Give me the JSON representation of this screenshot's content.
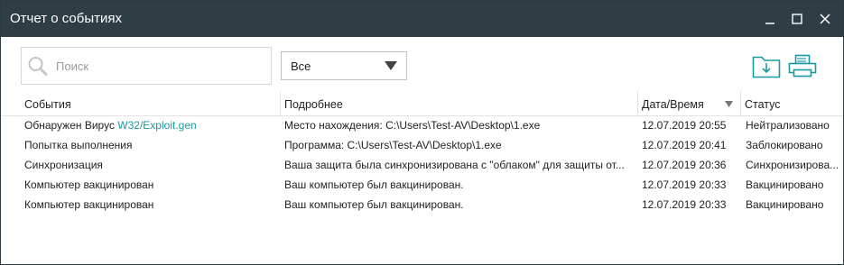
{
  "window": {
    "title": "Отчет о событиях"
  },
  "search": {
    "placeholder": "Поиск"
  },
  "filter": {
    "selected": "Все"
  },
  "columns": [
    "События",
    "Подробнее",
    "Дата/Время",
    "Статус"
  ],
  "rows": [
    {
      "event": "Обнаружен Вирус ",
      "virus": "W32/Exploit.gen",
      "details": "Место нахождения: C:\\Users\\Test-AV\\Desktop\\1.exe",
      "datetime": "12.07.2019 20:55",
      "status": "Нейтрализовано"
    },
    {
      "event": "Попытка выполнения",
      "virus": "",
      "details": "Программа: C:\\Users\\Test-AV\\Desktop\\1.exe",
      "datetime": "12.07.2019 20:41",
      "status": "Заблокировано"
    },
    {
      "event": "Синхронизация",
      "virus": "",
      "details": "Ваша защита была синхронизирована с \"облаком\" для защиты от...",
      "datetime": "12.07.2019 20:36",
      "status": "Синхронизирова..."
    },
    {
      "event": "Компьютер вакцинирован",
      "virus": "",
      "details": "Ваш компьютер был вакцинирован.",
      "datetime": "12.07.2019 20:33",
      "status": "Вакцинировано"
    },
    {
      "event": "Компьютер вакцинирован",
      "virus": "",
      "details": "Ваш компьютер был вакцинирован.",
      "datetime": "12.07.2019 20:33",
      "status": "Вакцинировано"
    }
  ],
  "icons": {
    "search": "search-icon",
    "dropdown": "chevron-down-icon",
    "export": "folder-download-icon",
    "print": "printer-icon",
    "minimize": "minimize-icon",
    "maximize": "maximize-icon",
    "close": "close-icon",
    "sort": "sort-desc-icon"
  },
  "colors": {
    "titlebar": "#2f3e44",
    "accent": "#1a9aa0"
  }
}
